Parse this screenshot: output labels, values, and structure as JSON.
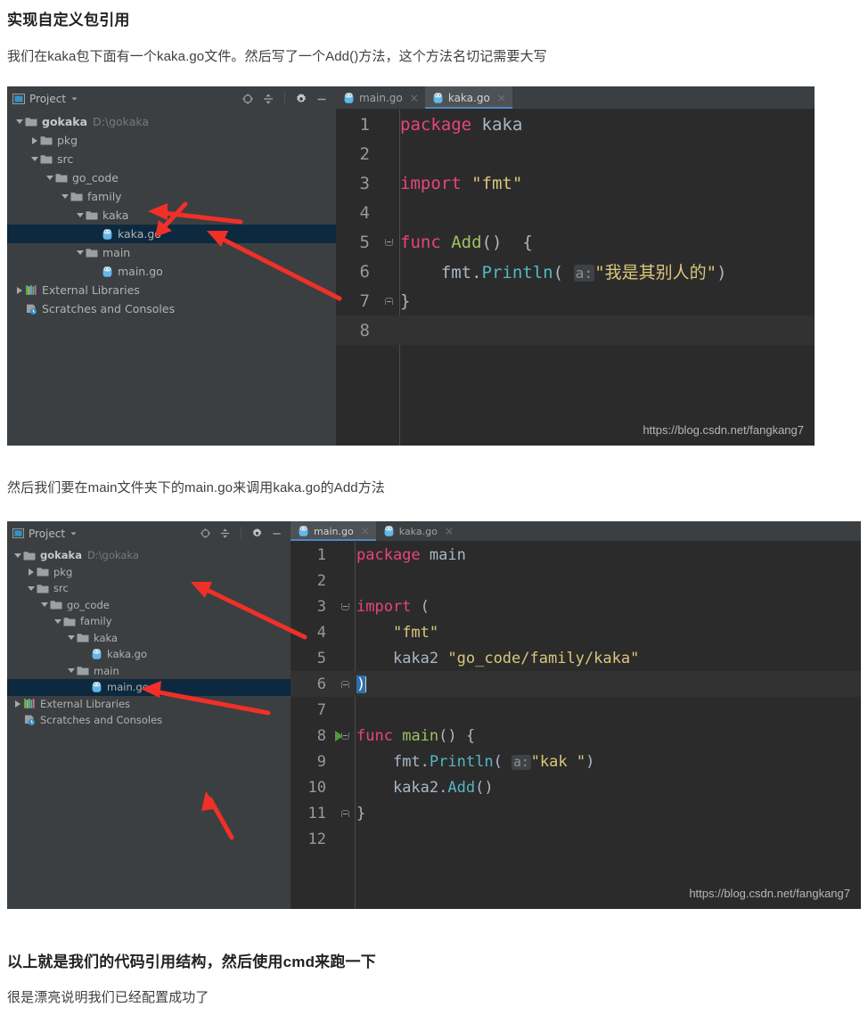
{
  "article": {
    "heading": "实现自定义包引用",
    "para1": "我们在kaka包下面有一个kaka.go文件。然后写了一个Add()方法，这个方法名切记需要大写",
    "para2": "然后我们要在main文件夹下的main.go来调用kaka.go的Add方法",
    "para3": "以上就是我们的代码引用结构，然后使用cmd来跑一下",
    "para4": "很是漂亮说明我们已经配置成功了"
  },
  "colors": {
    "ide_chrome": "#3c3f41",
    "editor_bg": "#2b2b2b",
    "selection_row": "#0d293f",
    "tab_active": "#4e5254",
    "tab_underline": "#4a88c7",
    "arrow_red": "#f03028",
    "keyword_pink": "#e8457b",
    "string_yellow": "#d9c77a",
    "func_green": "#a0c060",
    "method_cyan": "#56b6c2",
    "identifier": "#a9b7c6"
  },
  "ide1": {
    "panel": {
      "title": "Project",
      "title_icon": "project-panel-icon",
      "dropdown_icon": "chevron-down-icon",
      "tools": [
        {
          "name": "locate-in-tree-icon",
          "label": "⊕"
        },
        {
          "name": "collapse-all-icon",
          "label": "≑"
        },
        {
          "name": "settings-gear-icon",
          "label": "⚙"
        },
        {
          "name": "hide-panel-icon",
          "label": "—"
        }
      ]
    },
    "tree": [
      {
        "label": "gokaka",
        "sub": "D:\\gokaka",
        "icon": "folder-icon",
        "twisty": "down",
        "depth": 0,
        "bold": true,
        "selected": false
      },
      {
        "label": "pkg",
        "sub": "",
        "icon": "folder-icon",
        "twisty": "right",
        "depth": 1,
        "bold": false,
        "selected": false
      },
      {
        "label": "src",
        "sub": "",
        "icon": "folder-icon",
        "twisty": "down",
        "depth": 1,
        "bold": false,
        "selected": false
      },
      {
        "label": "go_code",
        "sub": "",
        "icon": "folder-icon",
        "twisty": "down",
        "depth": 2,
        "bold": false,
        "selected": false
      },
      {
        "label": "family",
        "sub": "",
        "icon": "folder-icon",
        "twisty": "down",
        "depth": 3,
        "bold": false,
        "selected": false
      },
      {
        "label": "kaka",
        "sub": "",
        "icon": "folder-icon",
        "twisty": "down",
        "depth": 4,
        "bold": false,
        "selected": false
      },
      {
        "label": "kaka.go",
        "sub": "",
        "icon": "go-file-icon",
        "twisty": "none",
        "depth": 5,
        "bold": false,
        "selected": true
      },
      {
        "label": "main",
        "sub": "",
        "icon": "folder-icon",
        "twisty": "down",
        "depth": 4,
        "bold": false,
        "selected": false
      },
      {
        "label": "main.go",
        "sub": "",
        "icon": "go-file-icon",
        "twisty": "none",
        "depth": 5,
        "bold": false,
        "selected": false
      },
      {
        "label": "External Libraries",
        "sub": "",
        "icon": "libraries-icon",
        "twisty": "right",
        "depth": 0,
        "bold": false,
        "selected": false
      },
      {
        "label": "Scratches and Consoles",
        "sub": "",
        "icon": "scratches-icon",
        "twisty": "none",
        "depth": 0,
        "bold": false,
        "selected": false
      }
    ],
    "tabs": [
      {
        "label": "main.go",
        "icon": "go-file-icon",
        "active": false,
        "close": "×"
      },
      {
        "label": "kaka.go",
        "icon": "go-file-icon",
        "active": true,
        "close": "×"
      }
    ],
    "code_lines": [
      {
        "n": "1",
        "text": "package kaka",
        "current": false
      },
      {
        "n": "2",
        "text": "",
        "current": false
      },
      {
        "n": "3",
        "text": "import \"fmt\"",
        "current": false
      },
      {
        "n": "4",
        "text": "",
        "current": false
      },
      {
        "n": "5",
        "text": "func Add()  {",
        "current": false
      },
      {
        "n": "6",
        "text": "    fmt.Println( a: \"我是其别人的\")",
        "current": false
      },
      {
        "n": "7",
        "text": "}",
        "current": false
      },
      {
        "n": "8",
        "text": "",
        "current": true
      }
    ],
    "watermark": "https://blog.csdn.net/fangkang7"
  },
  "ide2": {
    "panel": {
      "title": "Project",
      "title_icon": "project-panel-icon",
      "dropdown_icon": "chevron-down-icon",
      "tools": [
        {
          "name": "locate-in-tree-icon",
          "label": "⊕"
        },
        {
          "name": "collapse-all-icon",
          "label": "≑"
        },
        {
          "name": "settings-gear-icon",
          "label": "⚙"
        },
        {
          "name": "hide-panel-icon",
          "label": "—"
        }
      ]
    },
    "tree": [
      {
        "label": "gokaka",
        "sub": "D:\\gokaka",
        "icon": "folder-icon",
        "twisty": "down",
        "depth": 0,
        "bold": true,
        "selected": false
      },
      {
        "label": "pkg",
        "sub": "",
        "icon": "folder-icon",
        "twisty": "right",
        "depth": 1,
        "bold": false,
        "selected": false
      },
      {
        "label": "src",
        "sub": "",
        "icon": "folder-icon",
        "twisty": "down",
        "depth": 1,
        "bold": false,
        "selected": false
      },
      {
        "label": "go_code",
        "sub": "",
        "icon": "folder-icon",
        "twisty": "down",
        "depth": 2,
        "bold": false,
        "selected": false
      },
      {
        "label": "family",
        "sub": "",
        "icon": "folder-icon",
        "twisty": "down",
        "depth": 3,
        "bold": false,
        "selected": false
      },
      {
        "label": "kaka",
        "sub": "",
        "icon": "folder-icon",
        "twisty": "down",
        "depth": 4,
        "bold": false,
        "selected": false
      },
      {
        "label": "kaka.go",
        "sub": "",
        "icon": "go-file-icon",
        "twisty": "none",
        "depth": 5,
        "bold": false,
        "selected": false
      },
      {
        "label": "main",
        "sub": "",
        "icon": "folder-icon",
        "twisty": "down",
        "depth": 4,
        "bold": false,
        "selected": false
      },
      {
        "label": "main.go",
        "sub": "",
        "icon": "go-file-icon",
        "twisty": "none",
        "depth": 5,
        "bold": false,
        "selected": true
      },
      {
        "label": "External Libraries",
        "sub": "",
        "icon": "libraries-icon",
        "twisty": "right",
        "depth": 0,
        "bold": false,
        "selected": false
      },
      {
        "label": "Scratches and Consoles",
        "sub": "",
        "icon": "scratches-icon",
        "twisty": "none",
        "depth": 0,
        "bold": false,
        "selected": false
      }
    ],
    "tabs": [
      {
        "label": "main.go",
        "icon": "go-file-icon",
        "active": true,
        "close": "×"
      },
      {
        "label": "kaka.go",
        "icon": "go-file-icon",
        "active": false,
        "close": "×"
      }
    ],
    "code_lines": [
      {
        "n": "1",
        "text": "package main",
        "current": false
      },
      {
        "n": "2",
        "text": "",
        "current": false
      },
      {
        "n": "3",
        "text": "import (",
        "current": false
      },
      {
        "n": "4",
        "text": "    \"fmt\"",
        "current": false
      },
      {
        "n": "5",
        "text": "    kaka2 \"go_code/family/kaka\"",
        "current": false
      },
      {
        "n": "6",
        "text": ")",
        "current": true
      },
      {
        "n": "7",
        "text": "",
        "current": false
      },
      {
        "n": "8",
        "text": "func main() {",
        "current": false
      },
      {
        "n": "9",
        "text": "    fmt.Println( a: \"kak \")",
        "current": false
      },
      {
        "n": "10",
        "text": "    kaka2.Add()",
        "current": false
      },
      {
        "n": "11",
        "text": "}",
        "current": false
      },
      {
        "n": "12",
        "text": "",
        "current": false
      }
    ],
    "watermark": "https://blog.csdn.net/fangkang7"
  }
}
